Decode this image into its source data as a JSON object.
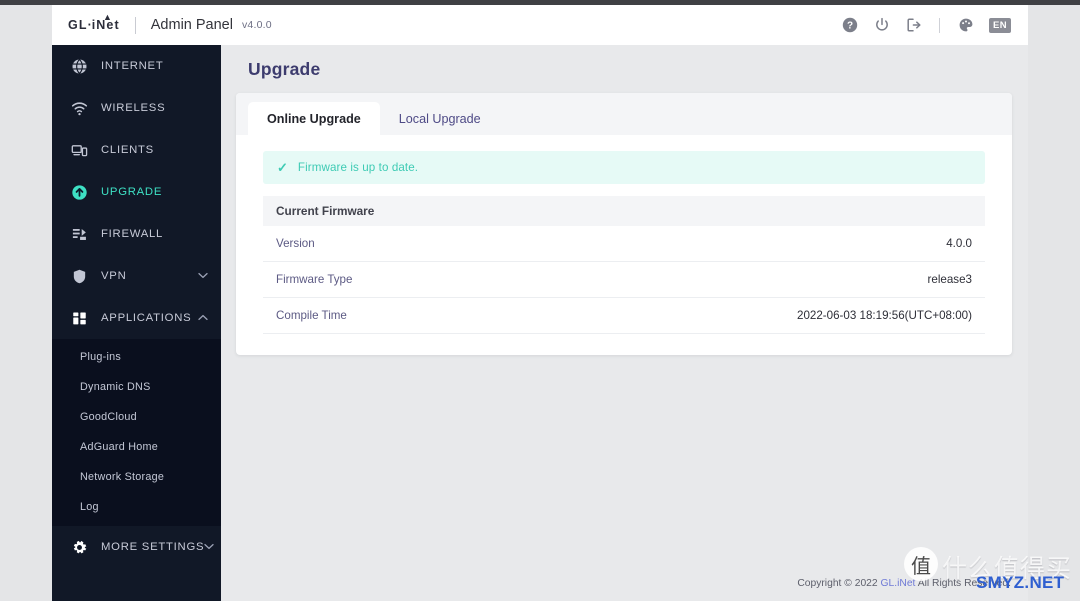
{
  "header": {
    "logo_text": "GL",
    "logo_dot": "·",
    "logo_inet": "iNet",
    "title": "Admin Panel",
    "version": "v4.0.0",
    "icons": [
      {
        "name": "help-icon",
        "label": "Help"
      },
      {
        "name": "power-icon",
        "label": "Reboot"
      },
      {
        "name": "logout-icon",
        "label": "Logout"
      },
      {
        "name": "theme-palette-icon",
        "label": "Theme"
      }
    ],
    "language": "EN"
  },
  "sidebar": {
    "items": [
      {
        "label": "INTERNET",
        "icon": "globe-icon",
        "active": false,
        "expandable": false
      },
      {
        "label": "WIRELESS",
        "icon": "wifi-icon",
        "active": false,
        "expandable": false
      },
      {
        "label": "CLIENTS",
        "icon": "devices-icon",
        "active": false,
        "expandable": false
      },
      {
        "label": "UPGRADE",
        "icon": "upload-circle-icon",
        "active": true,
        "expandable": false
      },
      {
        "label": "FIREWALL",
        "icon": "firewall-icon",
        "active": false,
        "expandable": false
      },
      {
        "label": "VPN",
        "icon": "shield-icon",
        "active": false,
        "expandable": true,
        "expanded": false
      },
      {
        "label": "APPLICATIONS",
        "icon": "grid-icon",
        "active": false,
        "expandable": true,
        "expanded": true
      },
      {
        "label": "MORE SETTINGS",
        "icon": "gear-icon",
        "active": false,
        "expandable": true,
        "expanded": false
      }
    ],
    "applications_submenu": [
      {
        "label": "Plug-ins"
      },
      {
        "label": "Dynamic DNS"
      },
      {
        "label": "GoodCloud"
      },
      {
        "label": "AdGuard Home"
      },
      {
        "label": "Network Storage"
      },
      {
        "label": "Log"
      }
    ],
    "chevron_down": "⌄",
    "chevron_up": "⌃"
  },
  "main": {
    "page_title": "Upgrade",
    "tabs": [
      {
        "label": "Online Upgrade",
        "active": true
      },
      {
        "label": "Local Upgrade",
        "active": false
      }
    ],
    "alert": {
      "icon": "check-icon",
      "check": "✓",
      "text": "Firmware is up to date."
    },
    "firmware": {
      "section_title": "Current Firmware",
      "rows": [
        {
          "key": "Version",
          "value": "4.0.0"
        },
        {
          "key": "Firmware Type",
          "value": "release3"
        },
        {
          "key": "Compile Time",
          "value": "2022-06-03 18:19:56(UTC+08:00)"
        }
      ]
    }
  },
  "footer": {
    "prefix": "Copyright © 2022 ",
    "link": "GL.iNet",
    "suffix": " All Rights Reserved."
  },
  "watermark": {
    "mark": "值",
    "chinese": "什么值得买",
    "domain": "SMYZ.NET"
  },
  "colors": {
    "sidebar_bg": "#111827",
    "submenu_bg": "#0a0f1e",
    "accent_teal": "#3ee0c4",
    "title_purple": "#3d3c6e",
    "alert_bg": "#e6faf6",
    "page_bg": "#e8e9eb"
  }
}
